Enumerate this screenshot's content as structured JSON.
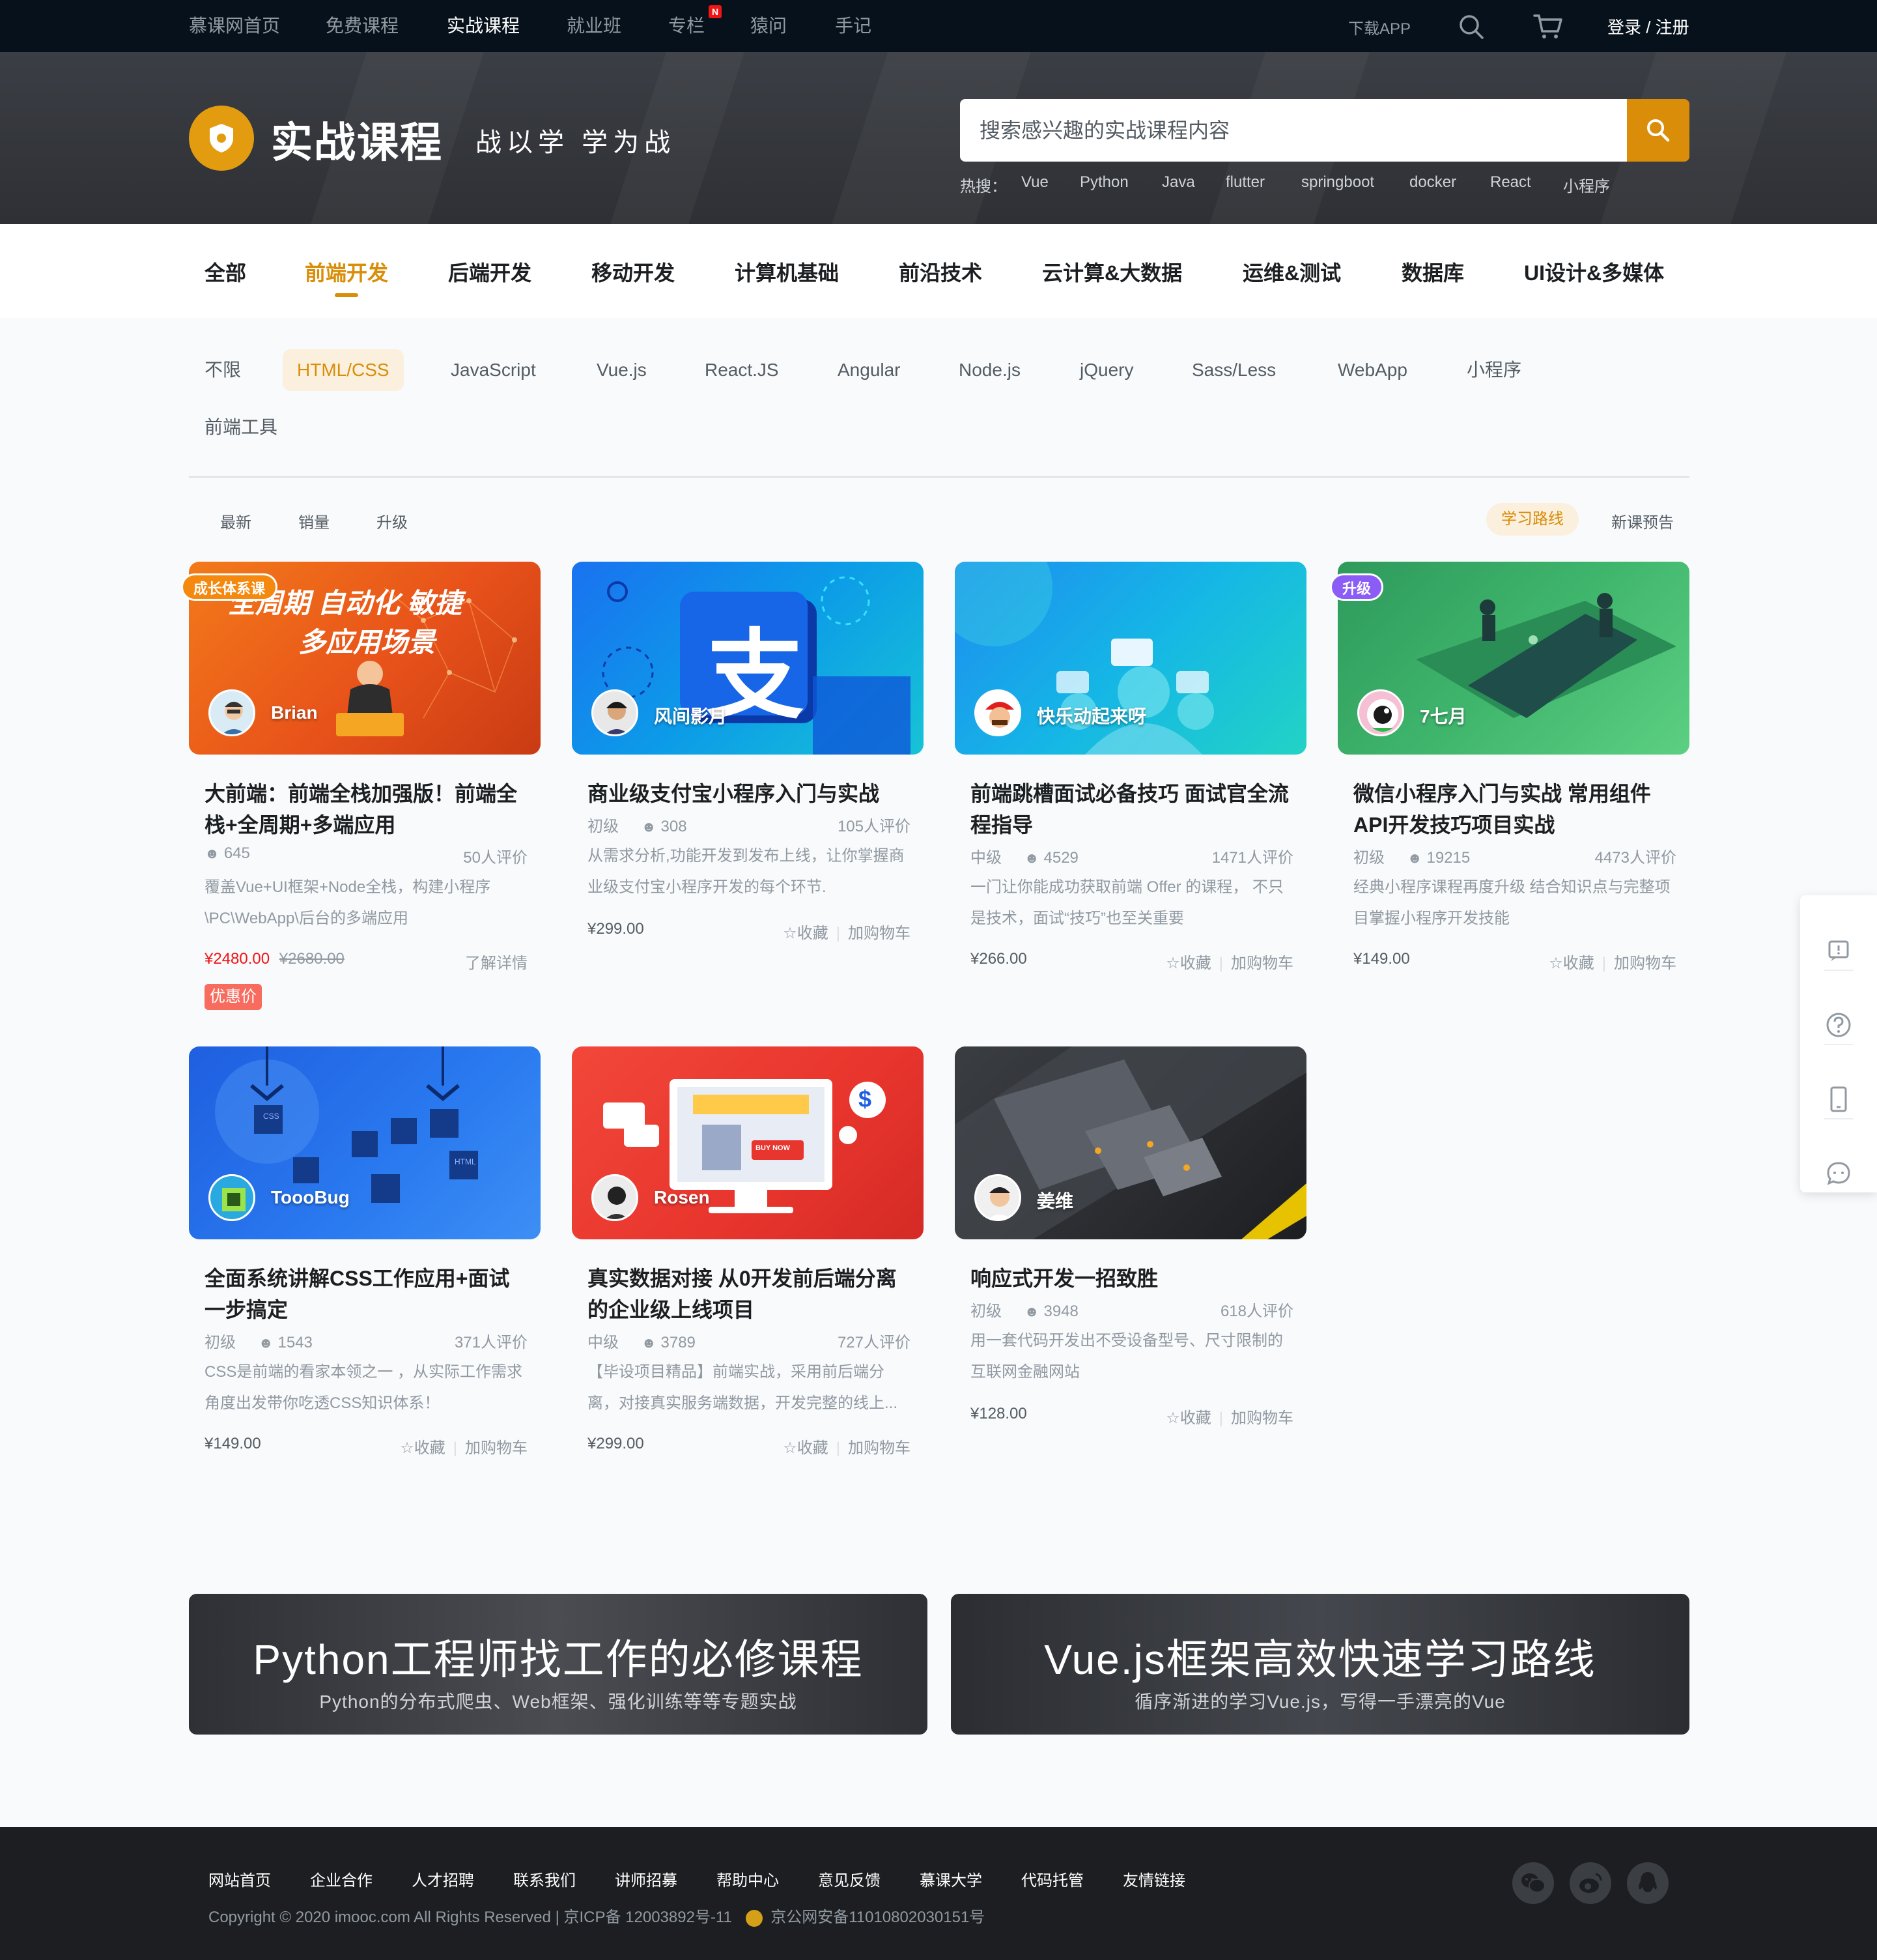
{
  "topnav": {
    "items": [
      "慕课网首页",
      "免费课程",
      "实战课程",
      "就业班",
      "专栏",
      "猿问",
      "手记"
    ],
    "new_badge": "N",
    "download": "下载APP",
    "login": "登录 / 注册",
    "icons": [
      "search-icon",
      "cart-icon"
    ]
  },
  "hero": {
    "title": "实战课程",
    "slogan": "战以学 学为战",
    "search_placeholder": "搜索感兴趣的实战课程内容",
    "hot_label": "热搜：",
    "hot": [
      "Vue",
      "Python",
      "Java",
      "flutter",
      "springboot",
      "docker",
      "React",
      "小程序"
    ],
    "accent": "#d98d09"
  },
  "categories": [
    "全部",
    "前端开发",
    "后端开发",
    "移动开发",
    "计算机基础",
    "前沿技术",
    "云计算&大数据",
    "运维&测试",
    "数据库",
    "UI设计&多媒体"
  ],
  "subcategories": [
    "不限",
    "HTML/CSS",
    "JavaScript",
    "Vue.js",
    "React.JS",
    "Angular",
    "Node.js",
    "jQuery",
    "Sass/Less",
    "WebApp",
    "小程序",
    "前端工具"
  ],
  "sort": {
    "options": [
      "最新",
      "销量",
      "升级"
    ],
    "route": "学习路线",
    "preview": "新课预告"
  },
  "common": {
    "collect": "收藏",
    "cart": "加购物车",
    "detail": "了解详情",
    "discount": "优惠价"
  },
  "courses": [
    {
      "tag": "成长体系课",
      "thumb_text_1": "全周期 自动化 敏捷",
      "thumb_text_2": "多应用场景",
      "teacher": "Brian",
      "title": "大前端：前端全栈加强版！前端全栈+全周期+多端应用",
      "level": "",
      "students": "645",
      "reviews": "50人评价",
      "desc": "覆盖Vue+UI框架+Node全栈，构建小程序\\PC\\WebApp\\后台的多端应用",
      "price": "¥2480.00",
      "old_price": "¥2680.00"
    },
    {
      "tag": "",
      "thumb_text_1": "支",
      "thumb_text_2": "",
      "teacher": "风间影月",
      "title": "商业级支付宝小程序入门与实战",
      "level": "初级",
      "students": "308",
      "reviews": "105人评价",
      "desc": "从需求分析,功能开发到发布上线，让你掌握商业级支付宝小程序开发的每个环节.",
      "price": "¥299.00",
      "old_price": ""
    },
    {
      "tag": "",
      "thumb_text_1": "",
      "thumb_text_2": "",
      "teacher": "快乐动起来呀",
      "title": "前端跳槽面试必备技巧 面试官全流程指导",
      "level": "中级",
      "students": "4529",
      "reviews": "1471人评价",
      "desc": "一门让你能成功获取前端 Offer 的课程， 不只是技术，面试“技巧”也至关重要",
      "price": "¥266.00",
      "old_price": ""
    },
    {
      "tag": "升级",
      "thumb_text_1": "",
      "thumb_text_2": "",
      "teacher": "7七月",
      "title": "微信小程序入门与实战 常用组件API开发技巧项目实战",
      "level": "初级",
      "students": "19215",
      "reviews": "4473人评价",
      "desc": "经典小程序课程再度升级 结合知识点与完整项目掌握小程序开发技能",
      "price": "¥149.00",
      "old_price": ""
    },
    {
      "tag": "",
      "thumb_text_1": "CSS",
      "thumb_text_2": "HTML",
      "teacher": "ToooBug",
      "title": "全面系统讲解CSS工作应用+面试一步搞定",
      "level": "初级",
      "students": "1543",
      "reviews": "371人评价",
      "desc": "CSS是前端的看家本领之一 ，从实际工作需求角度出发带你吃透CSS知识体系！",
      "price": "¥149.00",
      "old_price": ""
    },
    {
      "tag": "",
      "thumb_text_1": "BUY NOW",
      "thumb_text_2": "$",
      "teacher": "Rosen",
      "title": "真实数据对接 从0开发前后端分离的企业级上线项目",
      "level": "中级",
      "students": "3789",
      "reviews": "727人评价",
      "desc": "【毕设项目精品】前端实战，采用前后端分离，对接真实服务端数据，开发完整的线上...",
      "price": "¥299.00",
      "old_price": ""
    },
    {
      "tag": "",
      "thumb_text_1": "",
      "thumb_text_2": "",
      "teacher": "姜维",
      "title": "响应式开发一招致胜",
      "level": "初级",
      "students": "3948",
      "reviews": "618人评价",
      "desc": "用一套代码开发出不受设备型号、尺寸限制的互联网金融网站",
      "price": "¥128.00",
      "old_price": ""
    }
  ],
  "banners": [
    {
      "title": "Python工程师找工作的必修课程",
      "subtitle": "Python的分布式爬虫、Web框架、强化训练等等专题实战"
    },
    {
      "title": "Vue.js框架高效快速学习路线",
      "subtitle": "循序渐进的学习Vue.js，写得一手漂亮的Vue"
    }
  ],
  "sidebar_icons": [
    "feedback-icon",
    "help-icon",
    "mobile-icon",
    "chat-icon"
  ],
  "footer": {
    "links": [
      "网站首页",
      "企业合作",
      "人才招聘",
      "联系我们",
      "讲师招募",
      "帮助中心",
      "意见反馈",
      "慕课大学",
      "代码托管",
      "友情链接"
    ],
    "copyright": "Copyright  © 2020 imooc.com All Rights Reserved | 京ICP备 12003892号-11",
    "police": "京公网安备11010802030151号",
    "social_icons": [
      "wechat-icon",
      "weibo-icon",
      "qq-icon"
    ]
  }
}
